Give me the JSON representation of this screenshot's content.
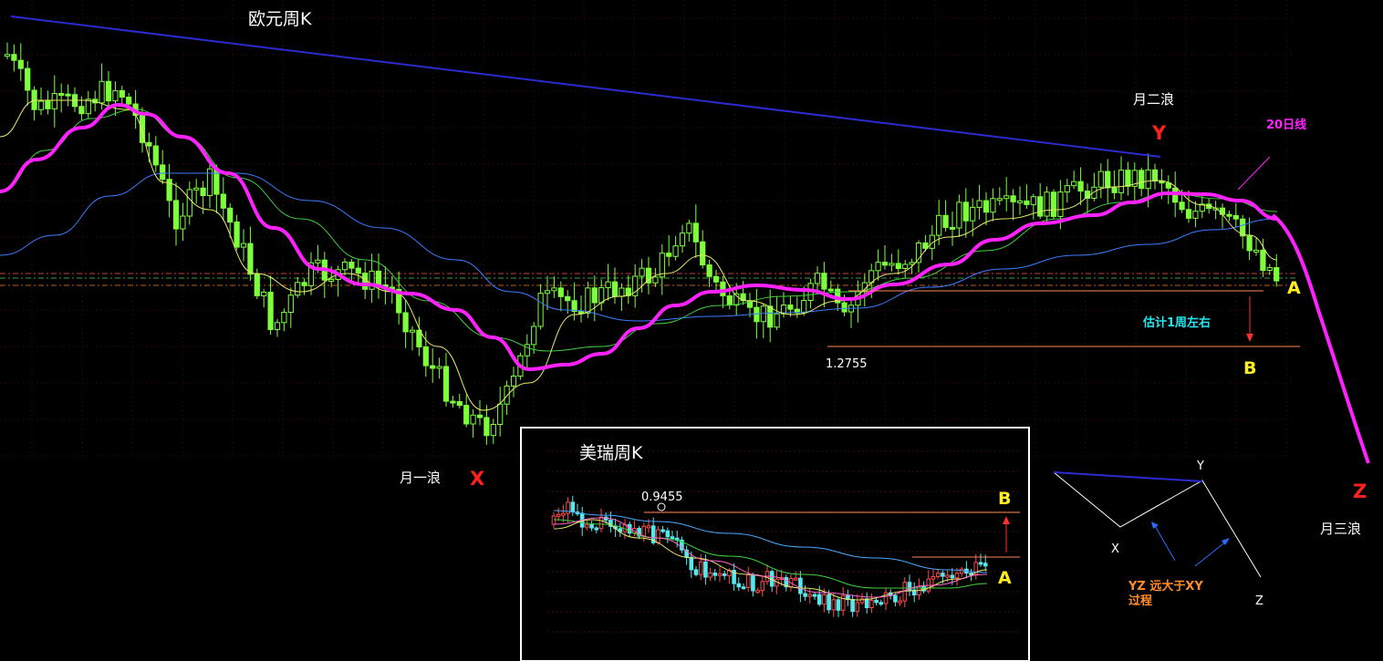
{
  "main_chart": {
    "title": "欧元周K",
    "colors": {
      "up": "#7dff3c",
      "down": "#7dff3c",
      "ma20": "#ff22ff",
      "ma_yellow": "#e8e86a",
      "ma_green": "#41d141",
      "ma_blue": "#3b7cff",
      "trendline": "#2b2bd0"
    },
    "annotations": {
      "wave1": "月一浪",
      "wave2": "月二浪",
      "wave3": "月三浪",
      "X": "X",
      "Y": "Y",
      "Z": "Z",
      "A": "A",
      "B": "B",
      "ma20_label": "20日线",
      "estimate": "估计1周左右",
      "price_low": "1.2755"
    }
  },
  "inset_chart": {
    "title": "美瑞周K",
    "price_label": "0.9455",
    "A": "A",
    "B": "B",
    "colors": {
      "up": "#ff4a4a",
      "down": "#55e8ee"
    }
  },
  "schematic": {
    "X": "X",
    "Y": "Y",
    "Z": "Z",
    "note_line1": "YZ 远大于XY",
    "note_line2": "过程"
  },
  "chart_data": [
    {
      "type": "candlestick",
      "title": "欧元周K",
      "series": [
        {
          "name": "20日线",
          "values": [
            0.28,
            0.36,
            0.44,
            0.5,
            0.54,
            0.53,
            0.48,
            0.42,
            0.33,
            0.22,
            0.13,
            0.06,
            0.04,
            0.08,
            0.16,
            0.21,
            0.22,
            0.2,
            0.18,
            0.17,
            0.21,
            0.28,
            0.34,
            0.39,
            0.43,
            0.46,
            0.48,
            0.47,
            0.44,
            0.38,
            0.28
          ]
        },
        {
          "name": "trendline",
          "values": [
            0.65,
            0.47
          ]
        }
      ],
      "waves": [
        "月一浪",
        "月二浪",
        "月三浪"
      ],
      "levels": [
        1.2755
      ]
    },
    {
      "type": "candlestick",
      "title": "美瑞周K",
      "levels": [
        0.9455
      ]
    }
  ]
}
